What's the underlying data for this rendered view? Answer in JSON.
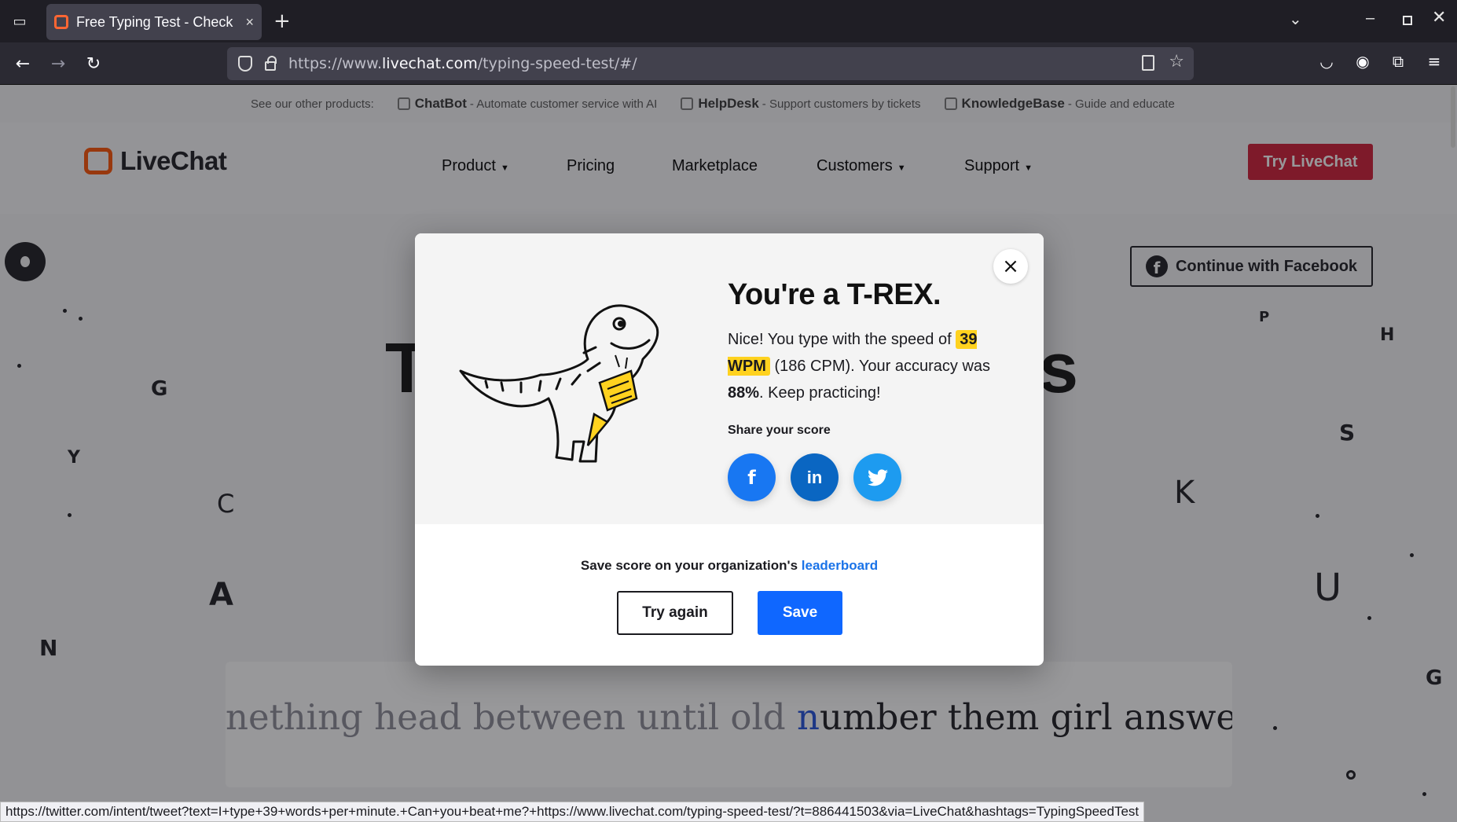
{
  "browser": {
    "tab_title": "Free Typing Test - Check",
    "tab_close": "×",
    "new_tab": "+",
    "url_prefix": "https://www.",
    "url_domain": "livechat.com",
    "url_path": "/typing-speed-test/#/",
    "status_url": "https://twitter.com/intent/tweet?text=I+type+39+words+per+minute.+Can+you+beat+me?+https://www.livechat.com/typing-speed-test/?t=886441503&via=LiveChat&hashtags=TypingSpeedTest"
  },
  "products_bar": {
    "label": "See our other products:",
    "items": [
      {
        "name": "ChatBot",
        "desc": "- Automate customer service with AI"
      },
      {
        "name": "HelpDesk",
        "desc": "- Support customers by tickets"
      },
      {
        "name": "KnowledgeBase",
        "desc": "- Guide and educate"
      }
    ]
  },
  "header": {
    "logo": "LiveChat",
    "menu": [
      "Product",
      "Pricing",
      "Marketplace",
      "Customers",
      "Support"
    ],
    "cta": "Try LiveChat"
  },
  "facebook_button": "Continue with Facebook",
  "hero": {
    "left_fragment": "T",
    "right_fragment": "s"
  },
  "typing": {
    "typed": "nething head between until old ",
    "current": "n",
    "remaining": "umber them girl answer high dee"
  },
  "modal": {
    "title": "You're a T-REX.",
    "line1": "Nice! You type with the speed of ",
    "wpm": "39 WPM",
    "cpm_text": " (186 CPM). Your accuracy was ",
    "accuracy": "88%",
    "end_text": ". Keep practicing!",
    "share_label": "Share your score",
    "share": {
      "facebook": "f",
      "linkedin": "in",
      "twitter": "t"
    },
    "save_note": "Save score on your organization's ",
    "leaderboard_link": "leaderboard",
    "try_again": "Try again",
    "save": "Save",
    "close": "×"
  },
  "colors": {
    "accent_red": "#d01a33",
    "save_blue": "#0f67ff",
    "wpm_highlight": "#ffd21f",
    "facebook": "#1877f2",
    "linkedin": "#0a66c2",
    "twitter": "#1d9bf0"
  }
}
